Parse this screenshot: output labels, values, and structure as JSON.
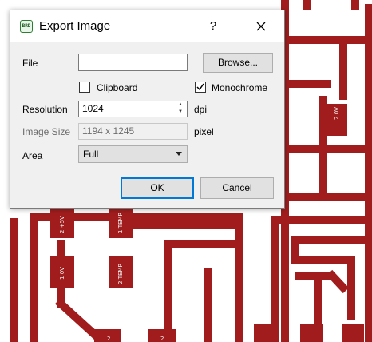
{
  "pcb": {
    "trace_color": "#a11d1d",
    "pads": [
      {
        "num": "2",
        "net": "0V"
      },
      {
        "num": "2",
        "net": "+5V"
      },
      {
        "num": "1",
        "net": "TEMP"
      },
      {
        "num": "1",
        "net": "0V"
      },
      {
        "num": "2",
        "net": "TEMP"
      },
      {
        "num": "2",
        "net": ""
      },
      {
        "num": "2",
        "net": ""
      }
    ]
  },
  "dialog": {
    "title": "Export Image",
    "app_icon_text": "BRD",
    "help_label": "?",
    "close_icon": "close-icon",
    "file": {
      "label": "File",
      "value": "",
      "browse_label": "Browse..."
    },
    "clipboard": {
      "label": "Clipboard",
      "checked": false
    },
    "monochrome": {
      "label": "Monochrome",
      "checked": true
    },
    "resolution": {
      "label": "Resolution",
      "value": "1024",
      "unit": "dpi"
    },
    "image_size": {
      "label": "Image Size",
      "value": "1194 x 1245",
      "unit": "pixel"
    },
    "area": {
      "label": "Area",
      "selected": "Full"
    },
    "ok_label": "OK",
    "cancel_label": "Cancel"
  }
}
